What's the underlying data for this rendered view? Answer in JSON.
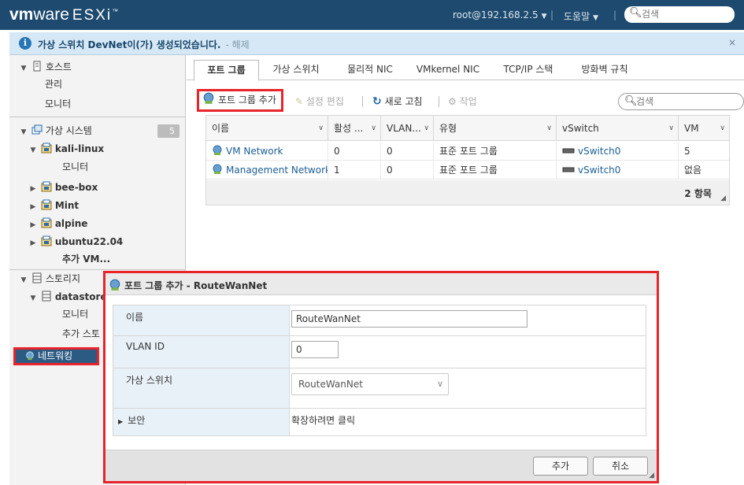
{
  "header": {
    "logo_vm": "vm",
    "logo_ware": "ware",
    "logo_product": "ESXi",
    "user": "root@192.168.2.5",
    "help": "도움말",
    "search_placeholder": "검색"
  },
  "notification": {
    "message": "가상 스위치 DevNet이(가) 생성되었습니다.",
    "dismiss": "- 해제",
    "close": "×"
  },
  "sidebar": {
    "host": "호스트",
    "host_manage": "관리",
    "host_monitor": "모니터",
    "vms": "가상 시스템",
    "vms_count": "5",
    "vm_list": [
      "kali-linux",
      "bee-box",
      "Mint",
      "alpine",
      "ubuntu22.04"
    ],
    "vm_monitor": "모니터",
    "vm_add": "추가 VM...",
    "storage": "스토리지",
    "datastore": "datastore",
    "ds_monitor": "모니터",
    "ds_add": "추가 스토",
    "networking": "네트워킹"
  },
  "tabs": [
    "포트 그룹",
    "가상 스위치",
    "물리적 NIC",
    "VMkernel NIC",
    "TCP/IP 스택",
    "방화벽 규칙"
  ],
  "toolbar": {
    "add": "포트 그룹 추가",
    "edit": "설정 편집",
    "refresh": "새로 고침",
    "actions": "작업",
    "search_placeholder": "검색"
  },
  "grid": {
    "columns": [
      "이름",
      "활성 ...",
      "VLAN...",
      "유형",
      "vSwitch",
      "VM"
    ],
    "rows": [
      {
        "name": "VM Network",
        "active": "0",
        "vlan": "0",
        "type": "표준 포트 그룹",
        "vswitch": "vSwitch0",
        "vm": "5"
      },
      {
        "name": "Management Network",
        "active": "1",
        "vlan": "0",
        "type": "표준 포트 그룹",
        "vswitch": "vSwitch0",
        "vm": "없음"
      }
    ],
    "count": "2 항목"
  },
  "modal": {
    "title": "포트 그룹 추가 - RouteWanNet",
    "name_label": "이름",
    "name_value": "RouteWanNet",
    "vlan_label": "VLAN ID",
    "vlan_value": "0",
    "vswitch_label": "가상 스위치",
    "vswitch_value": "RouteWanNet",
    "security_label": "보안",
    "security_value": "확장하려면 클릭",
    "add_button": "추가",
    "cancel_button": "취소"
  },
  "colors": {
    "header_bg": "#1d4a6e",
    "highlight": "#e8242a",
    "selected_nav": "#2b5a82",
    "link": "#1b5e95"
  }
}
